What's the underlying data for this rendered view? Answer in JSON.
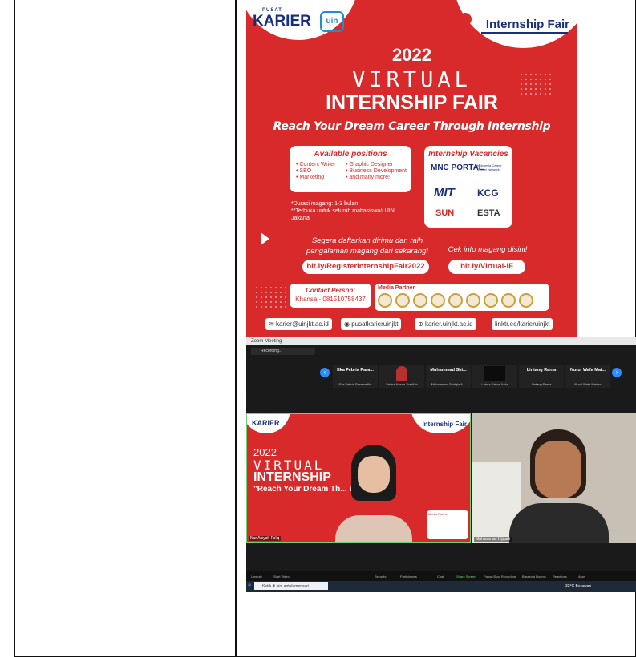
{
  "poster": {
    "org_logo": "KARIER",
    "org_logo_top": "PUSAT",
    "uin_logo": "uin",
    "fair_logo": "Internship Fair",
    "fair_logo_script": "Virtual",
    "year": "2022",
    "virtual": "VIRTUAL",
    "title": "INTERNSHIP FAIR",
    "tagline": "Reach Your Dream Career Through Internship",
    "positions_heading": "Available positions",
    "positions": [
      "Content Writer",
      "Graphic Designer",
      "SEO",
      "Business Development",
      "Marketing",
      "and many more!"
    ],
    "vacancies_heading": "Internship Vacancies",
    "vacancies": [
      "MNC PORTAL",
      "Indonesia Career Center Network",
      "MIT",
      "KCG",
      "SUN",
      "ESTA"
    ],
    "note1": "*Durasi magang: 1-3 bulan",
    "note2": "**Terbuka untuk seluruh mahasiswa/i UIN Jakarta",
    "cta_register": "Segera daftarkan dirimu dan raih pengalaman magang dari sekarang!",
    "cta_info": "Cek info magang disini!",
    "link_register": "bit.ly/RegisterInternshipFair2022",
    "link_info": "bit.ly/Virtual-IF",
    "contact_label": "Contact Person:",
    "contact_value": "Khansa - 081510758437",
    "media_partner": "Media Partner",
    "footer": [
      "karier@uinjkt.ac.id",
      "pusatkarieruinjkt",
      "karier.uinjkt.ac.id",
      "linktr.ee/karieruinjkt"
    ],
    "colors": {
      "red": "#d82a2a",
      "navy": "#1b2f7a"
    }
  },
  "zoom": {
    "window_title": "Zoom Meeting",
    "recording": "Recording...",
    "participants": [
      {
        "name": "Eka Febria Para...",
        "sub": "Eka Febria Paramadita"
      },
      {
        "name": "",
        "sub": "Selma Hasna Tsakilah"
      },
      {
        "name": "Muhammad Shi...",
        "sub": "Muhammad Shidqie A..."
      },
      {
        "name": "",
        "sub": "Lubna Salwa Azda"
      },
      {
        "name": "Lintang Rania",
        "sub": "Lintang Rania"
      },
      {
        "name": "Nurul Wafa Mai...",
        "sub": "Nurul Wafa Mainur"
      }
    ],
    "share_name": "Nur Aisyah Fa'iq",
    "cam_name": "Muhammad Hijaadi",
    "slide_fair": "Internship Fair",
    "slide_year": "2022",
    "slide_virtual": "VIRTUAL",
    "slide_internship": "INTERNSHIP",
    "slide_quote": "\"Reach Your Dream Th... ship\"",
    "slide_media": "Media Partner",
    "toolbar": [
      "Unmute",
      "Start Video",
      "Security",
      "Participants",
      "Chat",
      "Share Screen",
      "Pause/Stop Recording",
      "Breakout Rooms",
      "Reactions",
      "Apps"
    ],
    "participants_count": "14",
    "taskbar_search": "Ketik di sini untuk mencari",
    "weather": "32°C Berawan"
  }
}
